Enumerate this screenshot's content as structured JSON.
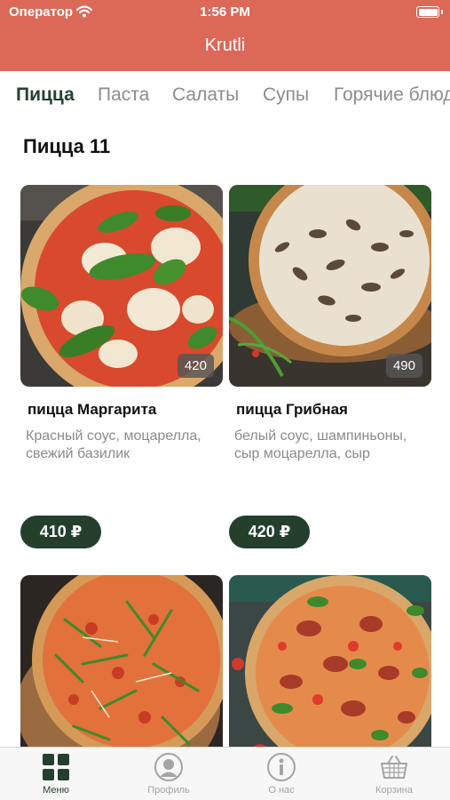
{
  "status_bar": {
    "carrier": "Оператор",
    "time": "1:56 PM"
  },
  "header": {
    "title": "Krutli"
  },
  "tabs": [
    {
      "label": "Пицца"
    },
    {
      "label": "Паста"
    },
    {
      "label": "Салаты"
    },
    {
      "label": "Супы"
    },
    {
      "label": "Горячие блюда"
    }
  ],
  "section": {
    "title": "Пицца 11"
  },
  "products": [
    {
      "name": "пицца Маргарита",
      "description": "Красный соус, моцарелла, свежий базилик",
      "weight": "420",
      "price": "410 ₽"
    },
    {
      "name": "пицца Грибная",
      "description": "белый соус, шампиньоны, сыр моцарелла, сыр",
      "weight": "490",
      "price": "420 ₽"
    },
    {
      "name": "",
      "description": "",
      "weight": "",
      "price": ""
    },
    {
      "name": "",
      "description": "",
      "weight": "",
      "price": ""
    }
  ],
  "tabbar": [
    {
      "label": "Меню",
      "icon": "grid-icon"
    },
    {
      "label": "Профиль",
      "icon": "profile-icon"
    },
    {
      "label": "О нас",
      "icon": "info-icon"
    },
    {
      "label": "Корзина",
      "icon": "basket-icon"
    }
  ],
  "colors": {
    "header": "#dc6858",
    "accent_dark_green": "#253f2d",
    "tab_inactive": "#8c8c8c",
    "description_text": "#8a8a8a"
  }
}
